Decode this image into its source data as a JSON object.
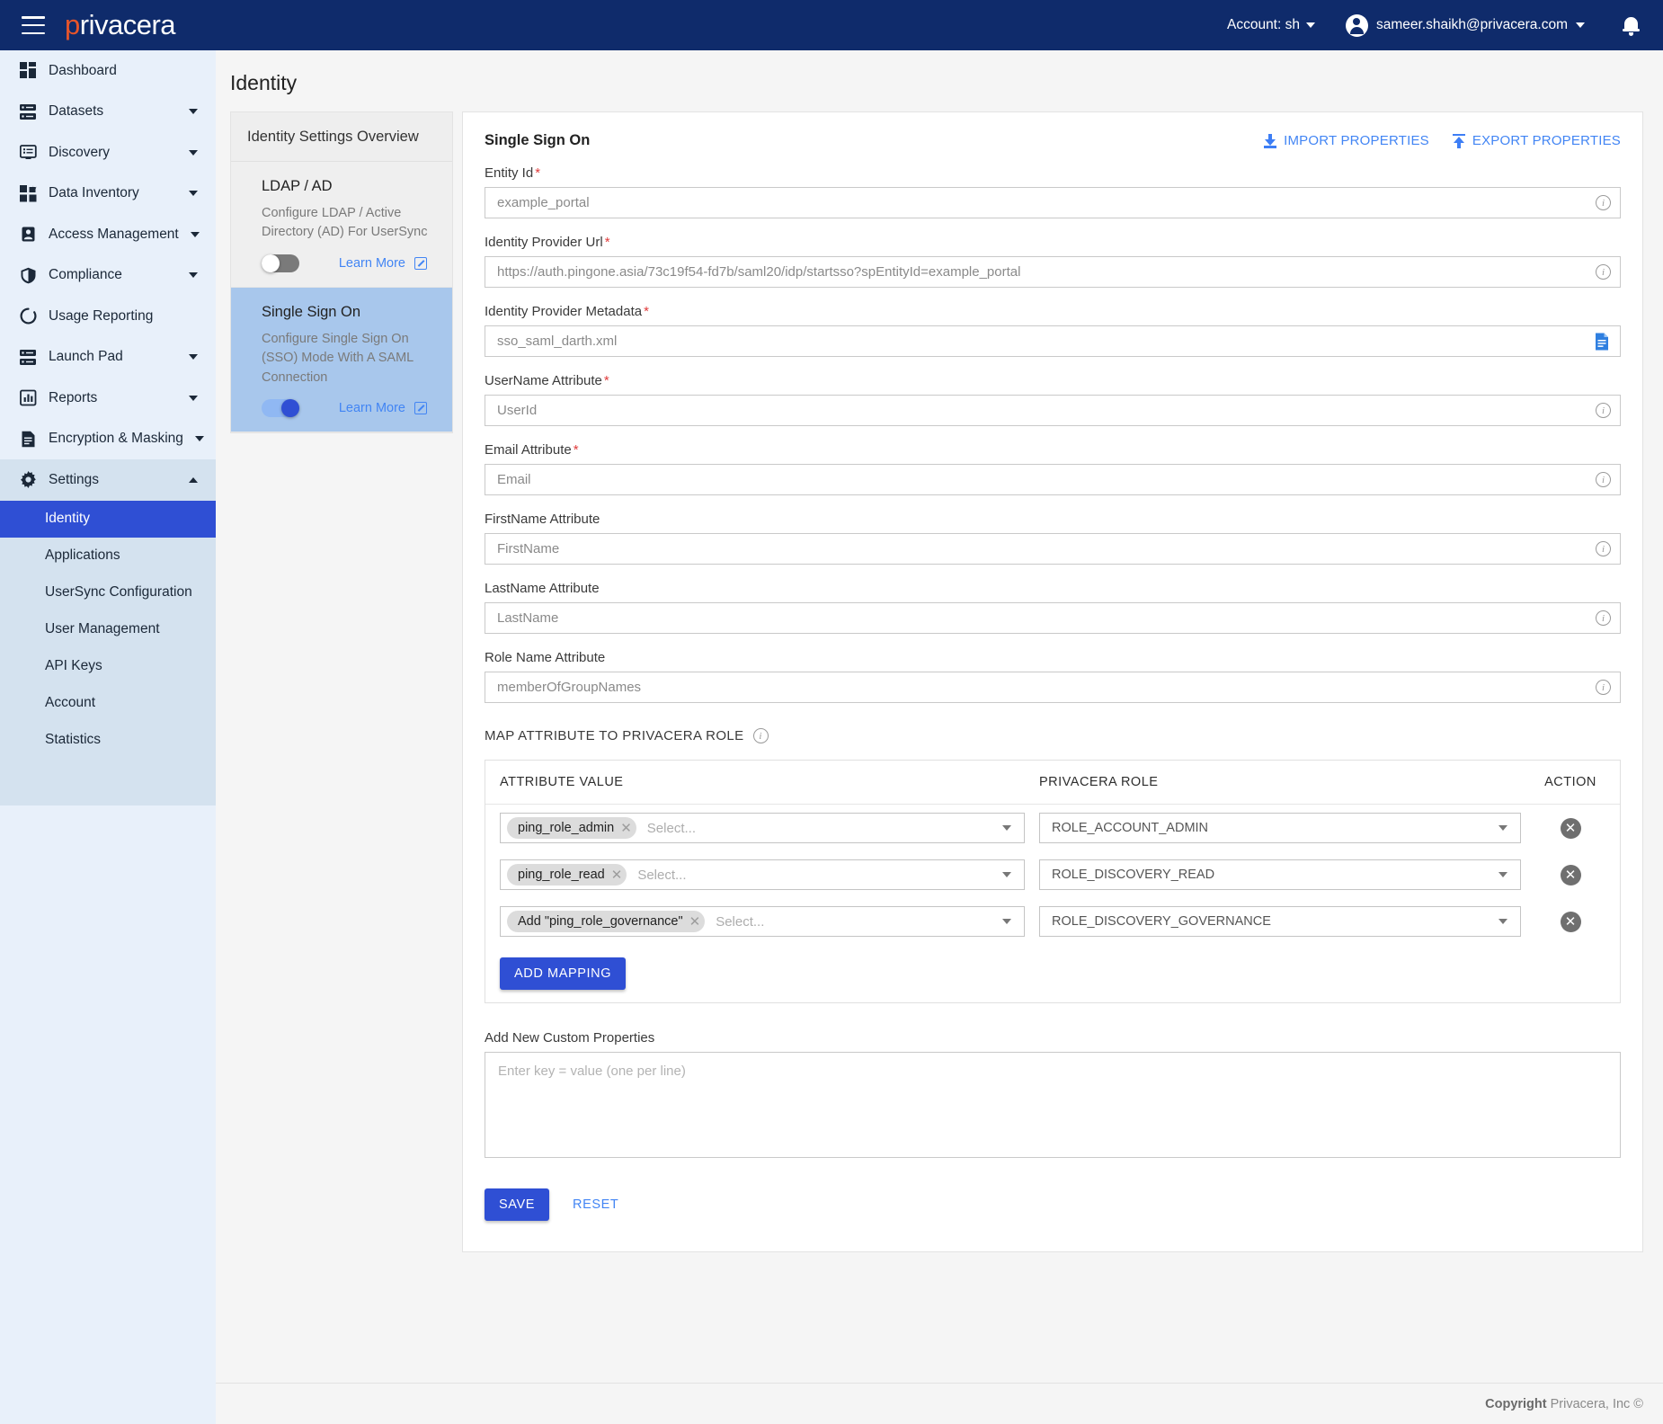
{
  "topbar": {
    "brand_p": "p",
    "brand_rest": "rivacera",
    "account_label": "Account: sh",
    "user_email": "sameer.shaikh@privacera.com"
  },
  "sidebar": {
    "items": [
      {
        "label": "Dashboard",
        "icon": "dashboard-icon",
        "expandable": false
      },
      {
        "label": "Datasets",
        "icon": "datasets-icon",
        "expandable": true
      },
      {
        "label": "Discovery",
        "icon": "discovery-icon",
        "expandable": true
      },
      {
        "label": "Data Inventory",
        "icon": "data-inventory-icon",
        "expandable": true
      },
      {
        "label": "Access Management",
        "icon": "access-management-icon",
        "expandable": true
      },
      {
        "label": "Compliance",
        "icon": "shield-icon",
        "expandable": true
      },
      {
        "label": "Usage Reporting",
        "icon": "usage-reporting-icon",
        "expandable": false
      },
      {
        "label": "Launch Pad",
        "icon": "launch-pad-icon",
        "expandable": true
      },
      {
        "label": "Reports",
        "icon": "reports-icon",
        "expandable": true
      },
      {
        "label": "Encryption & Masking",
        "icon": "encryption-masking-icon",
        "expandable": true
      },
      {
        "label": "Settings",
        "icon": "gear-icon",
        "expandable": true,
        "expanded": true
      }
    ],
    "settings_subitems": [
      {
        "label": "Identity",
        "active": true
      },
      {
        "label": "Applications",
        "active": false
      },
      {
        "label": "UserSync Configuration",
        "active": false
      },
      {
        "label": "User Management",
        "active": false
      },
      {
        "label": "API Keys",
        "active": false
      },
      {
        "label": "Account",
        "active": false
      },
      {
        "label": "Statistics",
        "active": false
      }
    ]
  },
  "page": {
    "title": "Identity"
  },
  "overview": {
    "header": "Identity Settings Overview",
    "cards": [
      {
        "title": "LDAP / AD",
        "desc": "Configure LDAP / Active Directory (AD) For UserSync",
        "toggle_on": false,
        "learn_more": "Learn More"
      },
      {
        "title": "Single Sign On",
        "desc": "Configure Single Sign On (SSO) Mode With A SAML Connection",
        "toggle_on": true,
        "learn_more": "Learn More"
      }
    ]
  },
  "main": {
    "heading": "Single Sign On",
    "import_label": "IMPORT PROPERTIES",
    "export_label": "EXPORT PROPERTIES",
    "fields": [
      {
        "label": "Entity Id",
        "required": true,
        "value": "example_portal",
        "placeholder": "example_portal",
        "trail": "info"
      },
      {
        "label": "Identity Provider Url",
        "required": true,
        "value": "https://auth.pingone.asia/73c19f54-fd7b/saml20/idp/startsso?spEntityId=example_portal",
        "placeholder": "",
        "trail": "info"
      },
      {
        "label": "Identity Provider Metadata",
        "required": true,
        "value": "sso_saml_darth.xml",
        "placeholder": "sso_saml_darth.xml",
        "trail": "file"
      },
      {
        "label": "UserName Attribute",
        "required": true,
        "value": "UserId",
        "placeholder": "UserId",
        "trail": "info"
      },
      {
        "label": "Email Attribute",
        "required": true,
        "value": "Email",
        "placeholder": "Email",
        "trail": "info"
      },
      {
        "label": "FirstName Attribute",
        "required": false,
        "value": "FirstName",
        "placeholder": "FirstName",
        "trail": "info"
      },
      {
        "label": "LastName Attribute",
        "required": false,
        "value": "LastName",
        "placeholder": "LastName",
        "trail": "info"
      },
      {
        "label": "Role Name Attribute",
        "required": false,
        "value": "memberOfGroupNames",
        "placeholder": "memberOfGroupNames",
        "trail": "info"
      }
    ],
    "map_section_title": "MAP ATTRIBUTE TO PRIVACERA ROLE",
    "map_columns": [
      "ATTRIBUTE VALUE",
      "PRIVACERA ROLE",
      "ACTION"
    ],
    "map_rows": [
      {
        "chip": "ping_role_admin",
        "select_placeholder": "Select...",
        "role": "ROLE_ACCOUNT_ADMIN"
      },
      {
        "chip": "ping_role_read",
        "select_placeholder": "Select...",
        "role": "ROLE_DISCOVERY_READ"
      },
      {
        "chip": "Add \"ping_role_governance\"",
        "select_placeholder": "Select...",
        "role": "ROLE_DISCOVERY_GOVERNANCE"
      }
    ],
    "add_mapping_label": "ADD MAPPING",
    "custom_props_label": "Add New Custom Properties",
    "custom_props_placeholder": "Enter key = value (one per line)",
    "save_label": "SAVE",
    "reset_label": "RESET"
  },
  "footer": {
    "copyright_bold": "Copyright",
    "copyright_rest": "Privacera, Inc ©"
  },
  "colors": {
    "brand_navy": "#0f2b6b",
    "accent_orange": "#e8552a",
    "primary_blue": "#2f4fd4",
    "link_blue": "#4285f4"
  }
}
